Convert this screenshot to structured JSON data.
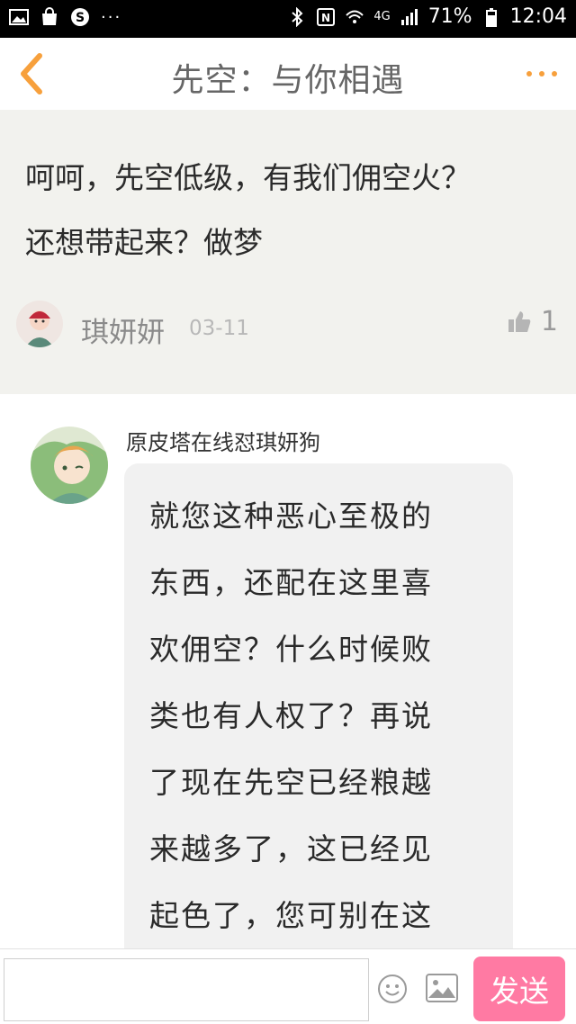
{
  "status_bar": {
    "battery_percent": "71%",
    "time": "12:04",
    "network": "4G",
    "overflow": "···"
  },
  "header": {
    "title": "先空：与你相遇"
  },
  "post": {
    "lines": [
      "呵呵，先空低级，有我们佣空火？",
      "还想带起来？做梦"
    ],
    "author": "琪妍妍",
    "date": "03-11",
    "likes": "1"
  },
  "reply": {
    "author": "原皮塔在线怼琪妍狗",
    "lines": [
      "就您这种恶心至极的",
      "东西，还配在这里喜",
      "欢佣空？什么时候败",
      "类也有人权了？再说",
      "了现在先空已经粮越",
      "来越多了，这已经见",
      "起色了，您可别在这"
    ]
  },
  "composer": {
    "input_value": "",
    "send_label": "发送"
  },
  "colors": {
    "accent": "#f7a03c",
    "send_button": "#ff7aa3",
    "post_background": "#f2f2ee"
  }
}
